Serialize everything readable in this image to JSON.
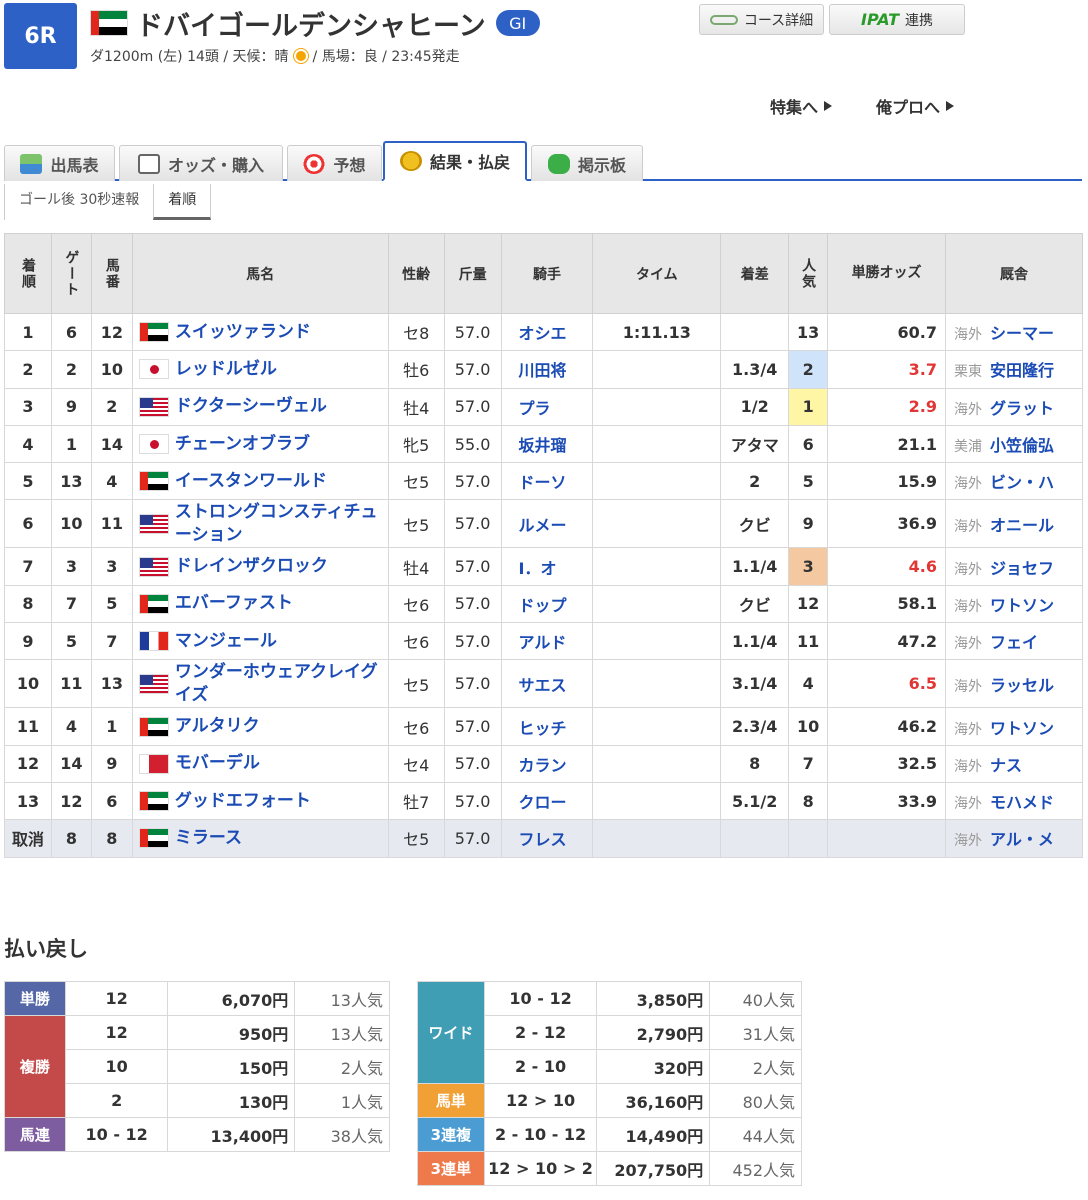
{
  "race": {
    "number": "6R",
    "name": "ドバイゴールデンシャヒーン",
    "grade": "GI",
    "meta_before_weather": "ダ1200m (左) 14頭 / 天候：晴",
    "meta_after_weather": "/ 馬場：良 / 23:45発走"
  },
  "header_buttons": {
    "course": "コース詳細",
    "ipat_logo": "IPAT",
    "ipat_label": "連携"
  },
  "links": {
    "feature": "特集へ",
    "orepro": "俺プロへ"
  },
  "tabs": [
    "出馬表",
    "オッズ・購入",
    "予想",
    "結果・払戻",
    "掲示板"
  ],
  "active_tab": "結果・払戻",
  "subtabs": [
    "ゴール後 30秒速報",
    "着順"
  ],
  "columns": [
    "着順",
    "ゲート",
    "馬番",
    "馬名",
    "性齢",
    "斤量",
    "騎手",
    "タイム",
    "着差",
    "人気",
    "単勝オッズ",
    "厩舎"
  ],
  "rows": [
    {
      "pos": "1",
      "gate": "6",
      "num": "12",
      "flag": "uae",
      "name": "スイッツァランド",
      "sexage": "セ8",
      "weight": "57.0",
      "jockey": "オシエ",
      "time": "1:11.13",
      "margin": "",
      "pop": "13",
      "odds": "60.7",
      "loc": "海外",
      "trainer": "シーマー"
    },
    {
      "pos": "2",
      "gate": "2",
      "num": "10",
      "flag": "jpn",
      "name": "レッドルゼル",
      "sexage": "牡6",
      "weight": "57.0",
      "jockey": "川田将",
      "time": "",
      "margin": "1.3/4",
      "pop": "2",
      "odds": "3.7",
      "loc": "栗東",
      "trainer": "安田隆行"
    },
    {
      "pos": "3",
      "gate": "9",
      "num": "2",
      "flag": "usa",
      "name": "ドクターシーヴェル",
      "sexage": "牡4",
      "weight": "57.0",
      "jockey": "プラ",
      "time": "",
      "margin": "1/2",
      "pop": "1",
      "odds": "2.9",
      "loc": "海外",
      "trainer": "グラット"
    },
    {
      "pos": "4",
      "gate": "1",
      "num": "14",
      "flag": "jpn",
      "name": "チェーンオブラブ",
      "sexage": "牝5",
      "weight": "55.0",
      "jockey": "坂井瑠",
      "time": "",
      "margin": "アタマ",
      "pop": "6",
      "odds": "21.1",
      "loc": "美浦",
      "trainer": "小笠倫弘"
    },
    {
      "pos": "5",
      "gate": "13",
      "num": "4",
      "flag": "uae",
      "name": "イースタンワールド",
      "sexage": "セ5",
      "weight": "57.0",
      "jockey": "ドーソ",
      "time": "",
      "margin": "2",
      "pop": "5",
      "odds": "15.9",
      "loc": "海外",
      "trainer": "ビン・ハ"
    },
    {
      "pos": "6",
      "gate": "10",
      "num": "11",
      "flag": "usa",
      "name": "ストロングコンスティチューション",
      "sexage": "セ5",
      "weight": "57.0",
      "jockey": "ルメー",
      "time": "",
      "margin": "クビ",
      "pop": "9",
      "odds": "36.9",
      "loc": "海外",
      "trainer": "オニール"
    },
    {
      "pos": "7",
      "gate": "3",
      "num": "3",
      "flag": "usa",
      "name": "ドレインザクロック",
      "sexage": "牡4",
      "weight": "57.0",
      "jockey": "I．オ",
      "time": "",
      "margin": "1.1/4",
      "pop": "3",
      "odds": "4.6",
      "loc": "海外",
      "trainer": "ジョセフ"
    },
    {
      "pos": "8",
      "gate": "7",
      "num": "5",
      "flag": "uae",
      "name": "エバーファスト",
      "sexage": "セ6",
      "weight": "57.0",
      "jockey": "ドップ",
      "time": "",
      "margin": "クビ",
      "pop": "12",
      "odds": "58.1",
      "loc": "海外",
      "trainer": "ワトソン"
    },
    {
      "pos": "9",
      "gate": "5",
      "num": "7",
      "flag": "fra",
      "name": "マンジェール",
      "sexage": "セ6",
      "weight": "57.0",
      "jockey": "アルド",
      "time": "",
      "margin": "1.1/4",
      "pop": "11",
      "odds": "47.2",
      "loc": "海外",
      "trainer": "フェイ"
    },
    {
      "pos": "10",
      "gate": "11",
      "num": "13",
      "flag": "usa",
      "name": "ワンダーホウェアクレイグイズ",
      "sexage": "セ5",
      "weight": "57.0",
      "jockey": "サエス",
      "time": "",
      "margin": "3.1/4",
      "pop": "4",
      "odds": "6.5",
      "loc": "海外",
      "trainer": "ラッセル"
    },
    {
      "pos": "11",
      "gate": "4",
      "num": "1",
      "flag": "uae",
      "name": "アルタリク",
      "sexage": "セ6",
      "weight": "57.0",
      "jockey": "ヒッチ",
      "time": "",
      "margin": "2.3/4",
      "pop": "10",
      "odds": "46.2",
      "loc": "海外",
      "trainer": "ワトソン"
    },
    {
      "pos": "12",
      "gate": "14",
      "num": "9",
      "flag": "bhr",
      "name": "モバーデル",
      "sexage": "セ4",
      "weight": "57.0",
      "jockey": "カラン",
      "time": "",
      "margin": "8",
      "pop": "7",
      "odds": "32.5",
      "loc": "海外",
      "trainer": "ナス"
    },
    {
      "pos": "13",
      "gate": "12",
      "num": "6",
      "flag": "uae",
      "name": "グッドエフォート",
      "sexage": "牡7",
      "weight": "57.0",
      "jockey": "クロー",
      "time": "",
      "margin": "5.1/2",
      "pop": "8",
      "odds": "33.9",
      "loc": "海外",
      "trainer": "モハメド"
    },
    {
      "pos": "取消",
      "gate": "8",
      "num": "8",
      "flag": "uae",
      "name": "ミラース",
      "sexage": "セ5",
      "weight": "57.0",
      "jockey": "フレス",
      "time": "",
      "margin": "",
      "pop": "",
      "odds": "",
      "loc": "海外",
      "trainer": "アル・メ"
    }
  ],
  "payout": {
    "title": "払い戻し",
    "tansho": {
      "label": "単勝",
      "nums": "12",
      "amount": "6,070円",
      "pop": "13人気"
    },
    "fukusho": {
      "label": "複勝",
      "items": [
        {
          "nums": "12",
          "amount": "950円",
          "pop": "13人気"
        },
        {
          "nums": "10",
          "amount": "150円",
          "pop": "2人気"
        },
        {
          "nums": "2",
          "amount": "130円",
          "pop": "1人気"
        }
      ]
    },
    "umaren": {
      "label": "馬連",
      "nums": "10 - 12",
      "amount": "13,400円",
      "pop": "38人気"
    },
    "wide": {
      "label": "ワイド",
      "items": [
        {
          "nums": "10 - 12",
          "amount": "3,850円",
          "pop": "40人気"
        },
        {
          "nums": "2 - 12",
          "amount": "2,790円",
          "pop": "31人気"
        },
        {
          "nums": "2 - 10",
          "amount": "320円",
          "pop": "2人気"
        }
      ]
    },
    "umatan": {
      "label": "馬単",
      "nums": "12 > 10",
      "amount": "36,160円",
      "pop": "80人気"
    },
    "sanrenpuku": {
      "label": "3連複",
      "nums": "2 - 10 - 12",
      "amount": "14,490円",
      "pop": "44人気"
    },
    "sanrentan": {
      "label": "3連単",
      "nums": "12 > 10 > 2",
      "amount": "207,750円",
      "pop": "452人気"
    }
  },
  "colors": {
    "accent": "#2e61c6",
    "link": "#1b4bb4",
    "odds_red": "#e23636",
    "pop1": "#fff6a5",
    "pop2": "#cfe3fb",
    "pop3": "#f4c9a1"
  }
}
